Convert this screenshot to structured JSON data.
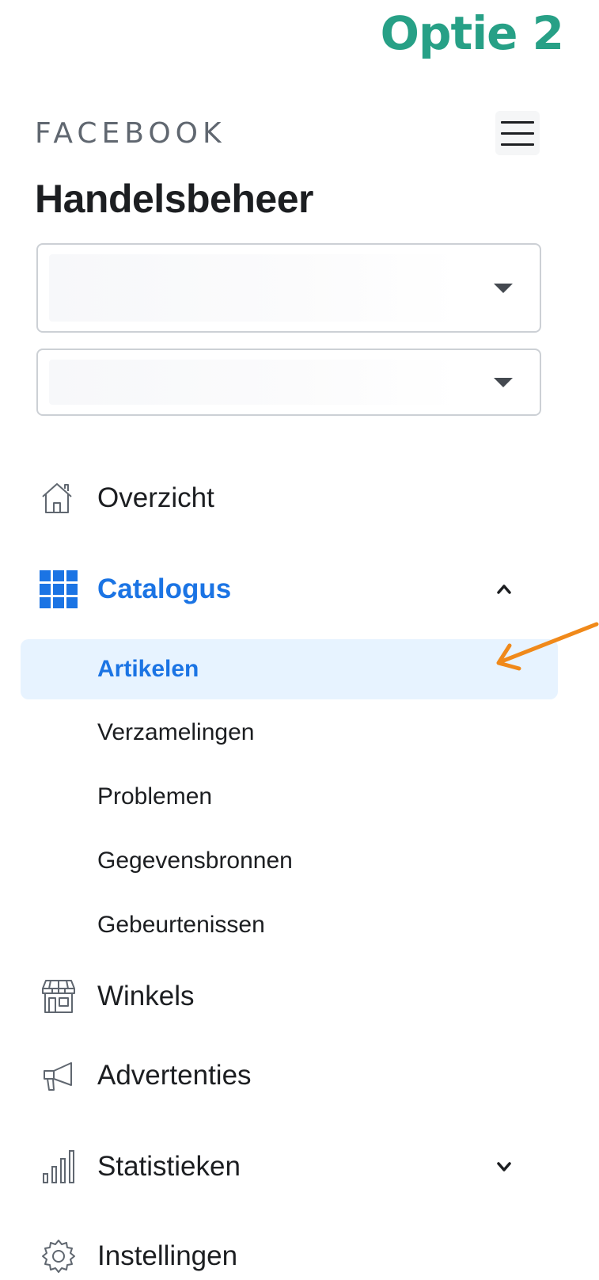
{
  "option_title": "Optie 2",
  "brand": "FACEBOOK",
  "app_title": "Handelsbeheer",
  "selectors": [
    {
      "value": ""
    },
    {
      "value": ""
    }
  ],
  "nav": {
    "overview": {
      "label": "Overzicht",
      "icon": "home-icon"
    },
    "catalog": {
      "label": "Catalogus",
      "icon": "grid-icon",
      "expanded": true
    },
    "catalog_items": [
      {
        "label": "Artikelen",
        "selected": true
      },
      {
        "label": "Verzamelingen",
        "selected": false
      },
      {
        "label": "Problemen",
        "selected": false
      },
      {
        "label": "Gegevensbronnen",
        "selected": false
      },
      {
        "label": "Gebeurtenissen",
        "selected": false
      }
    ],
    "shops": {
      "label": "Winkels",
      "icon": "shop-icon"
    },
    "ads": {
      "label": "Advertenties",
      "icon": "megaphone-icon"
    },
    "insights": {
      "label": "Statistieken",
      "icon": "bar-chart-icon",
      "expanded": false
    },
    "settings": {
      "label": "Instellingen",
      "icon": "gear-icon"
    }
  },
  "colors": {
    "option_title": "#27a086",
    "active_blue": "#1b74e4",
    "selected_bg": "#e7f3ff",
    "annotation_arrow": "#f0891a"
  }
}
